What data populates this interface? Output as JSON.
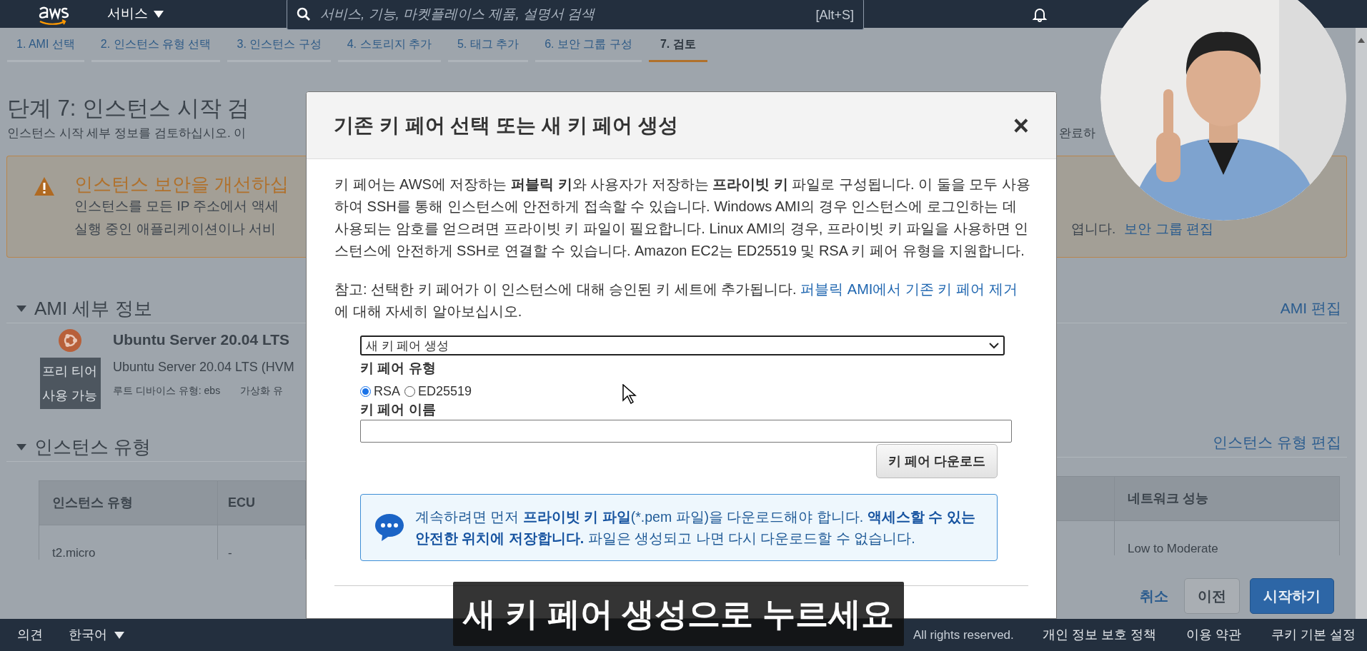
{
  "top_nav": {
    "services_menu": "서비스",
    "search": {
      "placeholder": "서비스, 기능, 마켓플레이스 제품, 설명서 검색",
      "shortcut": "[Alt+S]"
    }
  },
  "steps": [
    {
      "label": "1. AMI 선택",
      "selected": false
    },
    {
      "label": "2. 인스턴스 유형 선택",
      "selected": false
    },
    {
      "label": "3. 인스턴스 구성",
      "selected": false
    },
    {
      "label": "4. 스토리지 추가",
      "selected": false
    },
    {
      "label": "5. 태그 추가",
      "selected": false
    },
    {
      "label": "6. 보안 그룹 구성",
      "selected": false
    },
    {
      "label": "7. 검토",
      "selected": true
    }
  ],
  "page": {
    "title": "단계 7: 인스턴스 시작 검",
    "description": "인스턴스 시작 세부 정보를 검토하십시오. 이",
    "description_end": "완료하",
    "warning": {
      "title": "인스턴스 보안을 개선하십",
      "lines": [
        "인스턴스를 모든 IP 주소에서 액세",
        "실행 중인 애플리케이션이나 서비"
      ],
      "line_end": "엽니다.",
      "link": "보안 그룹 편집"
    },
    "ami_section": {
      "title": "AMI 세부 정보",
      "expanded": true,
      "edit_link": "AMI 편집",
      "name": "Ubuntu Server 20.04 LTS",
      "badge": "프리 티어 사용 가능",
      "description": "Ubuntu Server 20.04 LTS (HVM",
      "details": [
        "루트 디바이스 유형: ebs",
        "가상화 유"
      ]
    },
    "instance_section": {
      "title": "인스턴스 유형",
      "expanded": true,
      "edit_link": "인스턴스 유형 편집",
      "columns": [
        "인스턴스 유형",
        "ECU",
        "네트워크 성능"
      ],
      "rows": [
        [
          "t2.micro",
          "-",
          "Low to Moderate"
        ]
      ]
    },
    "actions": {
      "cancel": "취소",
      "previous": "이전",
      "launch": "시작하기"
    }
  },
  "dialog": {
    "title": "기존 키 페어 선택 또는 새 키 페어 생성",
    "close": "×",
    "intro": "키 페어는 AWS에 저장하는 **퍼블릭 키**와 사용자가 저장하는 **프라이빗 키** 파일로 구성됩니다. 이 둘을 모두 사용하여 SSH를 통해 인스턴스에 안전하게 접속할 수 있습니다. Windows AMI의 경우 인스턴스에 로그인하는 데 사용되는 암호를 얻으려면 프라이빗 키 파일이 필요합니다. Linux AMI의 경우, 프라이빗 키 파일을 사용하면 인스턴스에 안전하게 SSH로 연결할 수 있습니다. Amazon EC2는 ED25519 및 RSA 키 페어 유형을 지원합니다.",
    "note": {
      "text": "참고: 선택한 키 페어가 이 인스턴스에 대해 승인된 키 세트에 추가됩니다.",
      "link": "퍼블릭 AMI에서 기존 키 페어 제거",
      "text_after": "에 대해 자세히 알아보십시오."
    },
    "key_pair_select": {
      "value": "새 키 페어 생성"
    },
    "key_type": {
      "label": "키 페어 유형",
      "options": [
        {
          "label": "RSA",
          "selected": true
        },
        {
          "label": "ED25519",
          "selected": false
        }
      ]
    },
    "key_name": {
      "label": "키 페어 이름"
    },
    "download_button": "키 페어 다운로드",
    "info": "계속하려면 먼저 **프라이빗 키 파일**(*.pem 파일)을 다운로드해야 합니다. **액세스할 수 있는 안전한 위치에 저장합니다.** 파일은 생성되고 나면 다시 다운로드할 수 없습니다."
  },
  "footer": {
    "feedback": "의견",
    "language": "한국어",
    "copyright": "All rights reserved.",
    "links": [
      "개인 정보 보호 정책",
      "이용 약관",
      "쿠키 기본 설정"
    ]
  },
  "subtitle": "새 키 페어 생성으로 누르세요"
}
